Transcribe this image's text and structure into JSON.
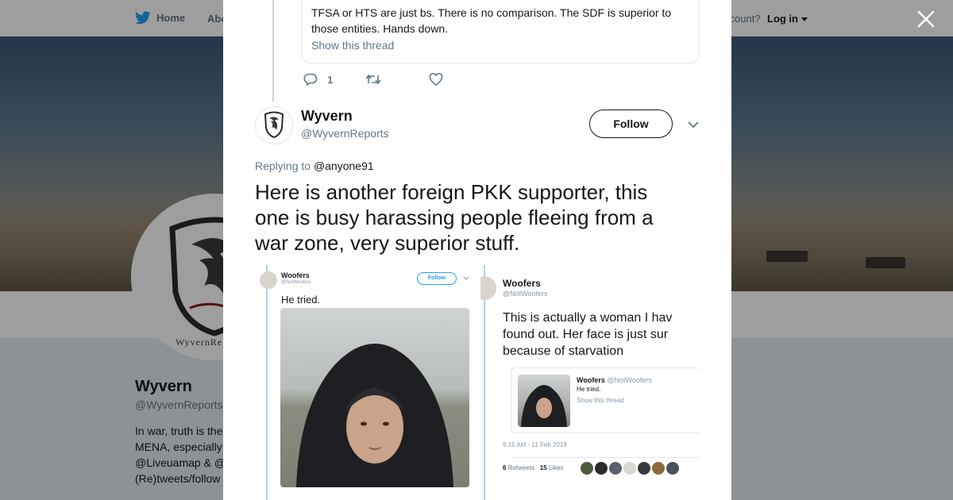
{
  "nav": {
    "home_label": "Home",
    "about_label": "Abo",
    "account_prompt": "ccount?",
    "login_label": "Log in"
  },
  "profile": {
    "name": "Wyvern",
    "handle": "@WyvernReports",
    "avatar_caption": "WyvernRe",
    "bio_lines": [
      "In war, truth is the",
      "MENA, especially",
      "@Liveuamap & @",
      "(Re)tweets/follow"
    ]
  },
  "modal": {
    "previous_tweet": {
      "quote_lines": [
        "TFSA or HTS are just bs. There is no comparison. The SDF is superior to",
        "those entities. Hands down."
      ],
      "show_thread_label": "Show this thread",
      "reply_count": "1"
    },
    "tweet": {
      "author_name": "Wyvern",
      "author_handle": "@WyvernReports",
      "follow_label": "Follow",
      "replying_prefix": "Replying to",
      "replying_to": "@anyone91",
      "text_lines": [
        "Here is another foreign PKK supporter, this",
        "one is busy harassing people fleeing from a",
        "war zone, very superior stuff."
      ]
    },
    "media_left": {
      "name": "Woofers",
      "handle": "@NotWoofers",
      "follow_label": "Follow",
      "text": "He tried."
    },
    "media_right": {
      "name": "Woofers",
      "handle": "@NotWoofers",
      "text_lines": [
        "This is actually a woman I hav",
        "found out. Her face is just sur",
        "because of starvation"
      ],
      "quoted_name": "Woofers",
      "quoted_handle": "@NotWoofers",
      "quoted_text": "He tried.",
      "quoted_link": "Show this thread",
      "timestamp": "9:15 AM - 11 Feb 2019",
      "retweets_count": "6",
      "retweets_label": "Retweets",
      "likes_count": "15",
      "likes_label": "Likes"
    }
  },
  "icons": {
    "brand": "bird-icon",
    "close": "close-icon",
    "reply": "reply-icon",
    "retweet": "retweet-icon",
    "like": "heart-icon",
    "caret": "chevron-down-icon"
  },
  "colors": {
    "brand_blue": "#1da1f2",
    "text_primary": "#14171a",
    "text_secondary": "#657786"
  }
}
